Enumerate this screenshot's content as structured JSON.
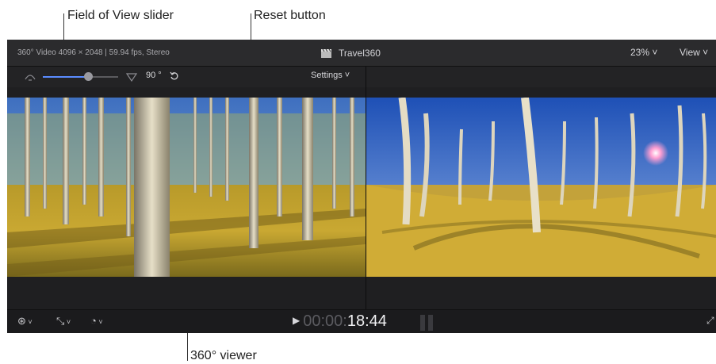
{
  "callouts": {
    "fov_slider": "Field of View slider",
    "reset_button": "Reset button",
    "viewer_360": "360° viewer"
  },
  "topbar": {
    "video_info": "360° Video 4096 × 2048 | 59.94 fps, Stereo",
    "project_title": "Travel360",
    "zoom": "23% ˅",
    "view_menu": "View ˅"
  },
  "viewer_toolbar": {
    "field_of_view": 0.6,
    "fov_value": "90 °",
    "settings_label": "Settings ˅"
  },
  "playback": {
    "timecode_dim": "00:00:",
    "timecode": "18:44"
  },
  "colors": {
    "slider_accent": "#5a8cff",
    "panel_bg": "#1f1f21"
  }
}
